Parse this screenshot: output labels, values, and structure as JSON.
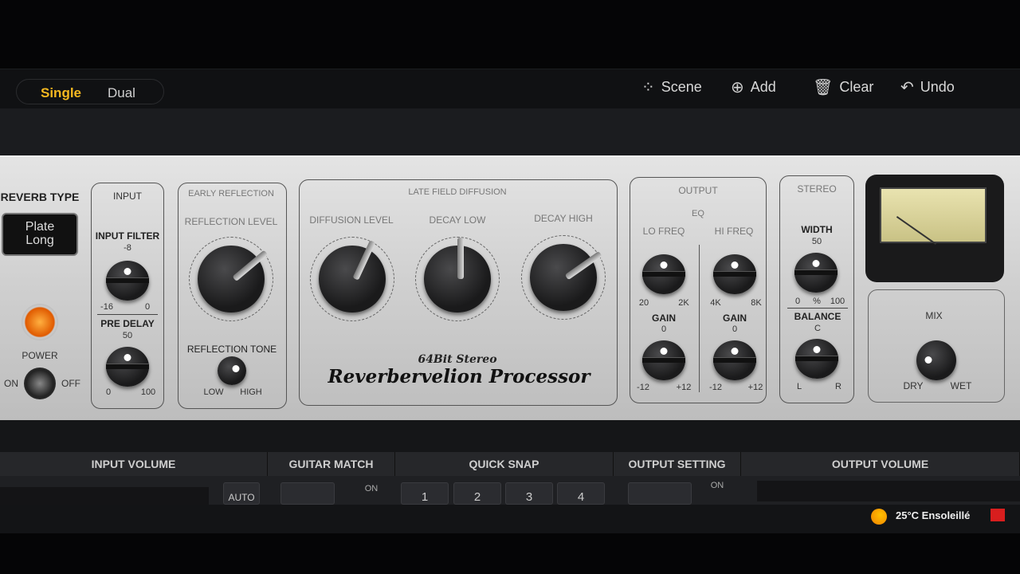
{
  "toolbar": {
    "modes": [
      "Single",
      "Dual"
    ],
    "active_mode": "Single",
    "actions": [
      {
        "label": "Scene",
        "icon": "scene-icon"
      },
      {
        "label": "Add",
        "icon": "plus-circle-icon"
      },
      {
        "label": "Clear",
        "icon": "trash-icon"
      },
      {
        "label": "Undo",
        "icon": "undo-icon"
      }
    ]
  },
  "panel": {
    "reverb_type": {
      "title": "REVERB TYPE",
      "value_line1": "Plate",
      "value_line2": "Long"
    },
    "power": {
      "label": "POWER",
      "on": "ON",
      "off": "OFF",
      "led_color": "#ff8a1a"
    },
    "input": {
      "title": "INPUT",
      "filter": {
        "label": "INPUT FILTER",
        "center": "-8",
        "min": "-16",
        "max": "0"
      },
      "pre_delay": {
        "label": "PRE DELAY",
        "center": "50",
        "min": "0",
        "max": "100"
      }
    },
    "early": {
      "title": "EARLY REFLECTION",
      "level": "REFLECTION LEVEL",
      "tone": {
        "label": "REFLECTION TONE",
        "min": "LOW",
        "max": "HIGH"
      }
    },
    "late": {
      "title": "LATE FIELD DIFFUSION",
      "knobs": [
        "DIFFUSION LEVEL",
        "DECAY LOW",
        "DECAY HIGH"
      ],
      "brand_line1": "64Bit Stereo",
      "brand_line2": "Reverbervelion Processor"
    },
    "output": {
      "title": "OUTPUT",
      "eq": "EQ",
      "lo": {
        "label": "LO FREQ",
        "min": "20",
        "max": "2K"
      },
      "hi": {
        "label": "HI FREQ",
        "min": "4K",
        "max": "8K"
      },
      "gain": {
        "label": "GAIN",
        "center": "0",
        "min": "-12",
        "max": "+12"
      }
    },
    "stereo": {
      "title": "STEREO",
      "width": {
        "label": "WIDTH",
        "center": "50",
        "min": "0",
        "unit": "%",
        "max": "100"
      },
      "balance": {
        "label": "BALANCE",
        "center": "C",
        "min": "L",
        "max": "R"
      }
    },
    "mix": {
      "label": "MIX",
      "min": "DRY",
      "max": "WET"
    }
  },
  "bottom": {
    "sections": [
      "INPUT VOLUME",
      "GUITAR MATCH",
      "QUICK SNAP",
      "OUTPUT SETTING",
      "OUTPUT VOLUME"
    ],
    "auto": "AUTO",
    "on": "ON",
    "snaps": [
      "1",
      "2",
      "3",
      "4"
    ]
  },
  "taskbar": {
    "weather": "25°C Ensoleillé"
  }
}
